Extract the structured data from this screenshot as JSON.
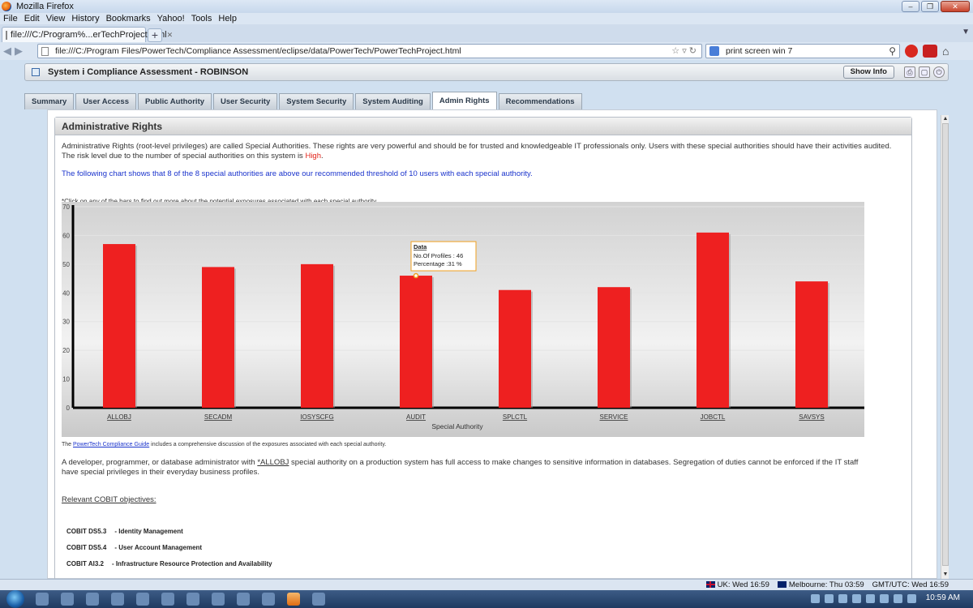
{
  "browser": {
    "window_title": "Mozilla Firefox",
    "menu": [
      "File",
      "Edit",
      "View",
      "History",
      "Bookmarks",
      "Yahoo!",
      "Tools",
      "Help"
    ],
    "tab_title": "file:///C:/Program%...erTechProject.html",
    "new_tab": "+",
    "url": "file:///C:/Program Files/PowerTech/Compliance Assessment/eclipse/data/PowerTech/PowerTechProject.html",
    "search_value": "print screen win 7"
  },
  "app": {
    "title": "System i Compliance Assessment - ROBINSON",
    "show_info": "Show Info",
    "tabs": [
      "Summary",
      "User Access",
      "Public Authority",
      "User Security",
      "System Security",
      "System Auditing",
      "Admin Rights",
      "Recommendations"
    ],
    "active_tab": "Admin Rights"
  },
  "section": {
    "heading": "Administrative Rights",
    "intro": "Administrative Rights (root-level privileges) are called Special Authorities. These rights are very powerful and should be for trusted and knowledgeable IT professionals only. Users with these special authorities should have their activities audited. The risk level due to the number of special authorities on this system is ",
    "risk_level": "High",
    "risk_suffix": ".",
    "chart_note": "The following chart shows that 8 of the 8 special authorities are above our recommended threshold of 10 users with each special authority.",
    "click_note": "*Click on any of the bars to find out more about the potential exposures associated with each special authority",
    "guide_link": "PowerTech Compliance Guide",
    "guide_prefix": "The ",
    "guide_suffix": " includes a comprehensive discussion of the exposures associated with each special authority.",
    "dev_prefix": "A developer, programmer, or database administrator with ",
    "dev_link": "*ALLOBJ",
    "dev_suffix": " special authority on a production system has full access to make changes to sensitive information in databases. Segregation of duties cannot be enforced if the IT staff have special privileges in their everyday business profiles.",
    "cobit_heading": "Relevant COBIT objectives:",
    "cobit": [
      {
        "code": "COBIT DS5.3",
        "desc": "- Identity Management"
      },
      {
        "code": "COBIT DS5.4",
        "desc": "- User Account Management"
      },
      {
        "code": "COBIT AI3.2",
        "desc": "- Infrastructure Resource Protection and Availability"
      }
    ]
  },
  "chart_data": {
    "type": "bar",
    "categories": [
      "ALLOBJ",
      "SECADM",
      "IOSYSCFG",
      "AUDIT",
      "SPLCTL",
      "SERVICE",
      "JOBCTL",
      "SAVSYS"
    ],
    "values": [
      57,
      49,
      50,
      46,
      41,
      42,
      61,
      44
    ],
    "xlabel": "Special Authority",
    "ylabel": "",
    "ylim": [
      0,
      70
    ],
    "yticks": [
      0,
      10,
      20,
      30,
      40,
      50,
      60,
      70
    ],
    "bar_color": "#ee2020",
    "tooltip": {
      "title": "Data",
      "line1": "No.Of Profiles : 46",
      "line2": "Percentage :31 %",
      "category": "AUDIT"
    }
  },
  "statusbar": {
    "uk": "UK: Wed 16:59",
    "melbourne": "Melbourne: Thu 03:59",
    "gmt": "GMT/UTC: Wed 16:59"
  },
  "taskbar": {
    "clock": "10:59 AM"
  }
}
